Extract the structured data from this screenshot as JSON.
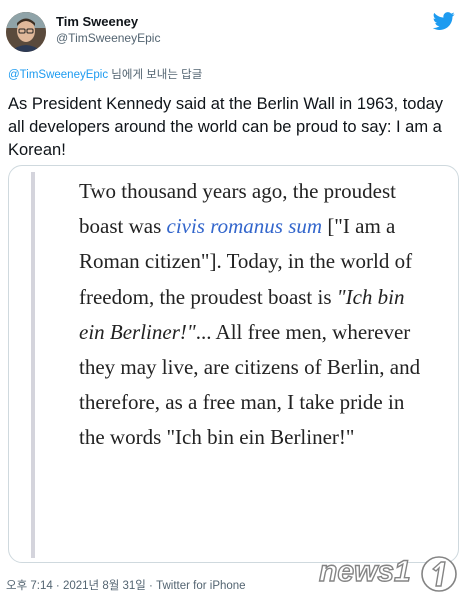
{
  "author": {
    "name": "Tim Sweeney",
    "handle": "@TimSweeneyEpic"
  },
  "icons": {
    "brand": "twitter-bird-icon",
    "avatar": "profile-photo"
  },
  "reply": {
    "mention": "@TimSweeneyEpic",
    "suffix": " 님에게 보내는 답글"
  },
  "tweet": {
    "text": "As President Kennedy said at the Berlin Wall in 1963, today all developers around the world can be proud to say: I am a Korean!"
  },
  "quote_image": {
    "part1": "Two thousand years ago, the proudest boast was ",
    "latin": "civis romanus sum",
    "part2": " [\"I am a Roman citizen\"]. Today, in the world of freedom, the proudest boast is ",
    "german": "\"Ich bin ein Berliner!\"",
    "part3": "... All free men, wherever they may live, are citizens of Berlin, and therefore, as a free man, I take pride in the words \"Ich bin ein Berliner!\""
  },
  "meta": {
    "timestamp": "오후 7:14 · 2021년 8월 31일",
    "separator": " · ",
    "source": "Twitter for iPhone"
  },
  "watermark": {
    "text": "news1"
  },
  "colors": {
    "accent": "#1d9bf0",
    "text_primary": "#0f1419",
    "text_secondary": "#536471",
    "quote_link": "#3366cc",
    "quote_bar": "#d4d4dc",
    "card_border": "#cfd9de"
  }
}
